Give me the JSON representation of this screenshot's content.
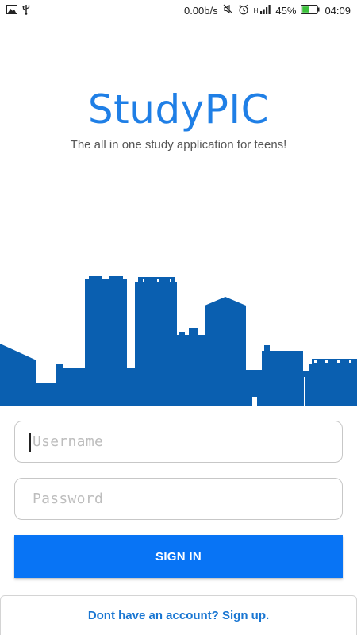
{
  "status_bar": {
    "left_icons": [
      "image-icon",
      "usb-icon"
    ],
    "net_speed": "0.00b/s",
    "right_icons": [
      "mute-icon",
      "alarm-icon",
      "signal-icon",
      "battery-icon"
    ],
    "network_type": "H",
    "battery_percent": "45%",
    "time": "04:09"
  },
  "branding": {
    "title": "StudyPIC",
    "tagline": "The all in one study application for teens!",
    "brand_color": "#1f7fe6"
  },
  "illustration": {
    "type": "city-skyline",
    "color": "#0a5fb0"
  },
  "form": {
    "username_placeholder": "Username",
    "username_value": "",
    "password_placeholder": "Password",
    "password_value": "",
    "signin_label": "SIGN IN",
    "signin_color": "#0874f5"
  },
  "footer": {
    "signup_text": "Dont have an account? Sign up."
  }
}
